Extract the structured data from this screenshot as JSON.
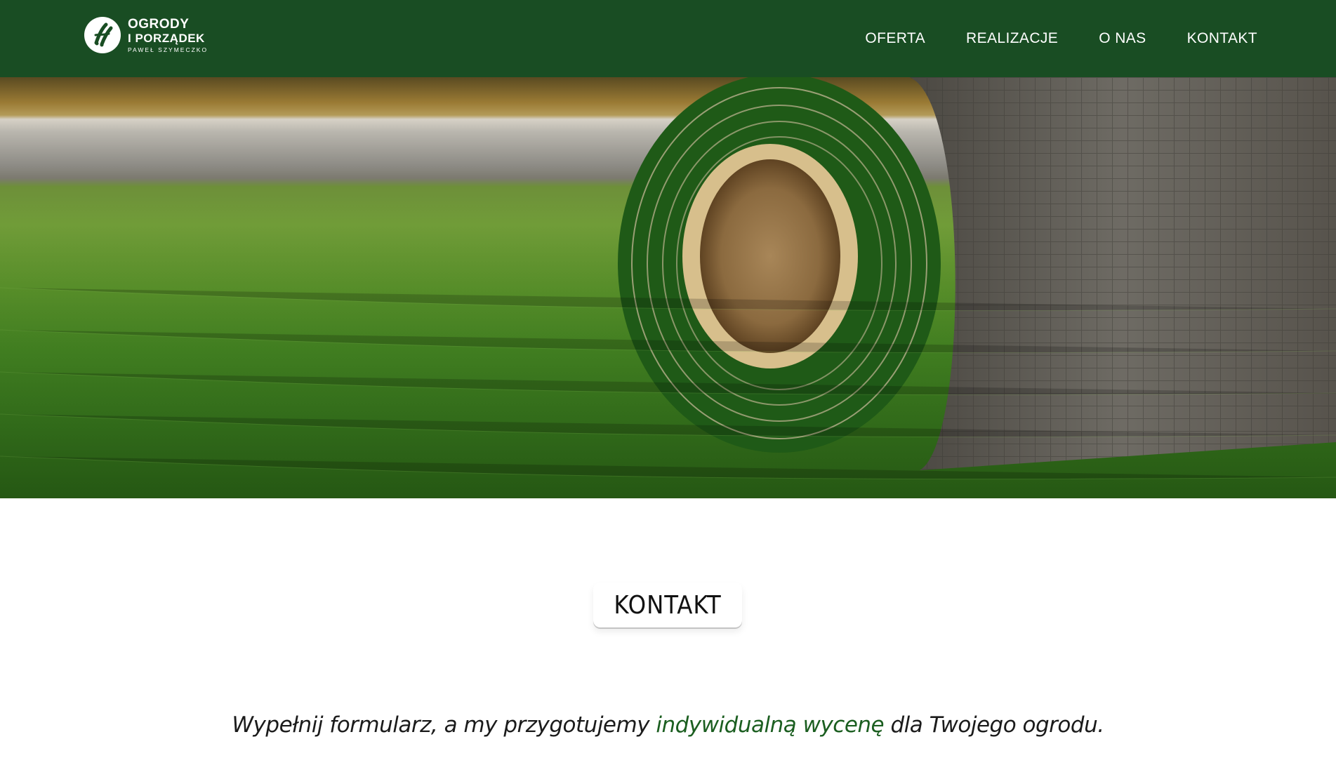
{
  "brand": {
    "line1": "OGRODY",
    "line2": "I PORZĄDEK",
    "line3": "PAWEŁ SZYMECZKO",
    "logo_icon": "garden-tools-icon",
    "colors": {
      "header": "#194d23",
      "accent": "#1b5e20"
    }
  },
  "nav": {
    "items": [
      {
        "label": "OFERTA"
      },
      {
        "label": "REALIZACJE"
      },
      {
        "label": "O NAS"
      },
      {
        "label": "KONTAKT"
      }
    ]
  },
  "hero": {
    "image": "rolled-artificial-grass-photo"
  },
  "contact": {
    "title": "KONTAKT",
    "intro_before": "Wypełnij formularz, a my przygotujemy ",
    "intro_highlight": "indywidualną wycenę",
    "intro_after": " dla Twojego ogrodu."
  }
}
